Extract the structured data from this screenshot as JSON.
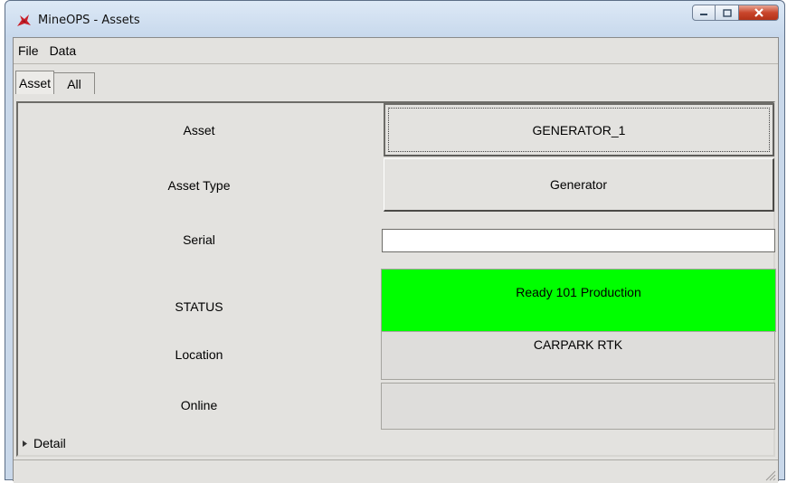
{
  "window": {
    "title": "MineOPS - Assets",
    "controls": {
      "minimize_icon": "minimize-icon",
      "maximize_icon": "maximize-icon",
      "close_icon": "close-icon"
    }
  },
  "menu": [
    {
      "label": "File"
    },
    {
      "label": "Data"
    }
  ],
  "tabs": [
    {
      "label": "Asset",
      "selected": true
    },
    {
      "label": "All",
      "selected": false
    }
  ],
  "fields": {
    "asset": {
      "label": "Asset",
      "value": "GENERATOR_1"
    },
    "asset_type": {
      "label": "Asset Type",
      "value": "Generator"
    },
    "serial": {
      "label": "Serial",
      "value": ""
    },
    "status": {
      "label": "STATUS",
      "value": "Ready 101 Production",
      "color": "#00ff00"
    },
    "location": {
      "label": "Location",
      "value": "CARPARK RTK"
    },
    "online": {
      "label": "Online",
      "value": ""
    }
  },
  "detail": {
    "label": "Detail",
    "icon": "triangle-right-icon"
  },
  "colors": {
    "titlebar": "#c7d8ec",
    "client": "#e3e2df",
    "status_ok": "#00ff00",
    "close_button": "#c9462c"
  }
}
